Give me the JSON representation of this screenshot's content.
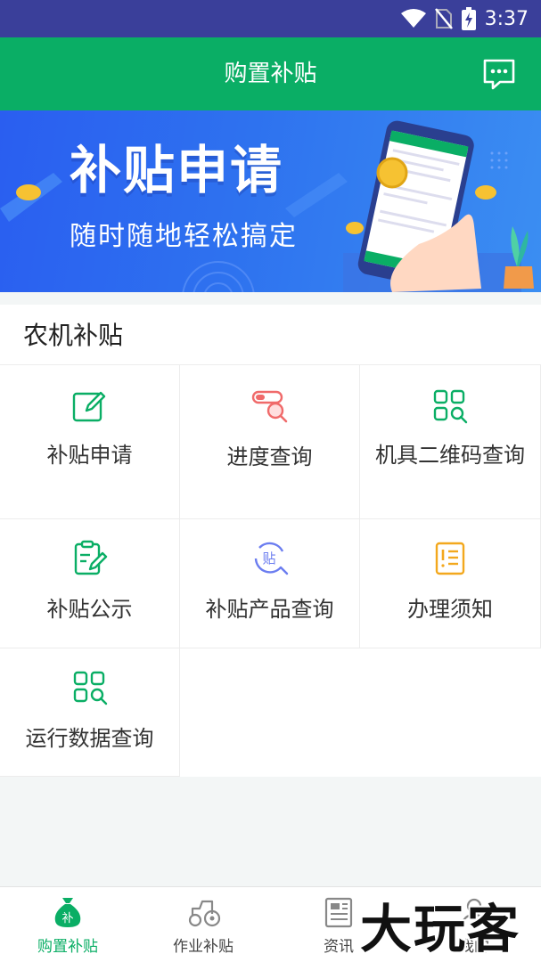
{
  "status_bar": {
    "time": "3:37"
  },
  "header": {
    "title": "购置补贴"
  },
  "banner": {
    "title": "补贴申请",
    "subtitle": "随时随地轻松搞定"
  },
  "section": {
    "title": "农机补贴",
    "items": [
      {
        "label": "补贴申请",
        "icon": "edit-icon"
      },
      {
        "label": "进度查询",
        "icon": "progress-search-icon"
      },
      {
        "label": "机具二维码查询",
        "icon": "qr-search-icon"
      },
      {
        "label": "补贴公示",
        "icon": "clipboard-edit-icon"
      },
      {
        "label": "补贴产品查询",
        "icon": "product-search-icon"
      },
      {
        "label": "办理须知",
        "icon": "notice-icon"
      },
      {
        "label": "运行数据查询",
        "icon": "data-search-icon"
      }
    ]
  },
  "bottom_nav": {
    "tabs": [
      {
        "label": "购置补贴",
        "icon": "money-bag-icon",
        "active": true
      },
      {
        "label": "作业补贴",
        "icon": "tractor-icon",
        "active": false
      },
      {
        "label": "资讯",
        "icon": "news-icon",
        "active": false
      },
      {
        "label": "我的",
        "icon": "user-icon",
        "active": false
      }
    ]
  },
  "watermark": "大玩客",
  "colors": {
    "primary_green": "#0aae65",
    "status_bar": "#3a3f9a",
    "banner_blue": "#2e72ef",
    "icon_red": "#f06a6a",
    "icon_purple": "#6b7df0",
    "icon_orange": "#f3a81d"
  }
}
